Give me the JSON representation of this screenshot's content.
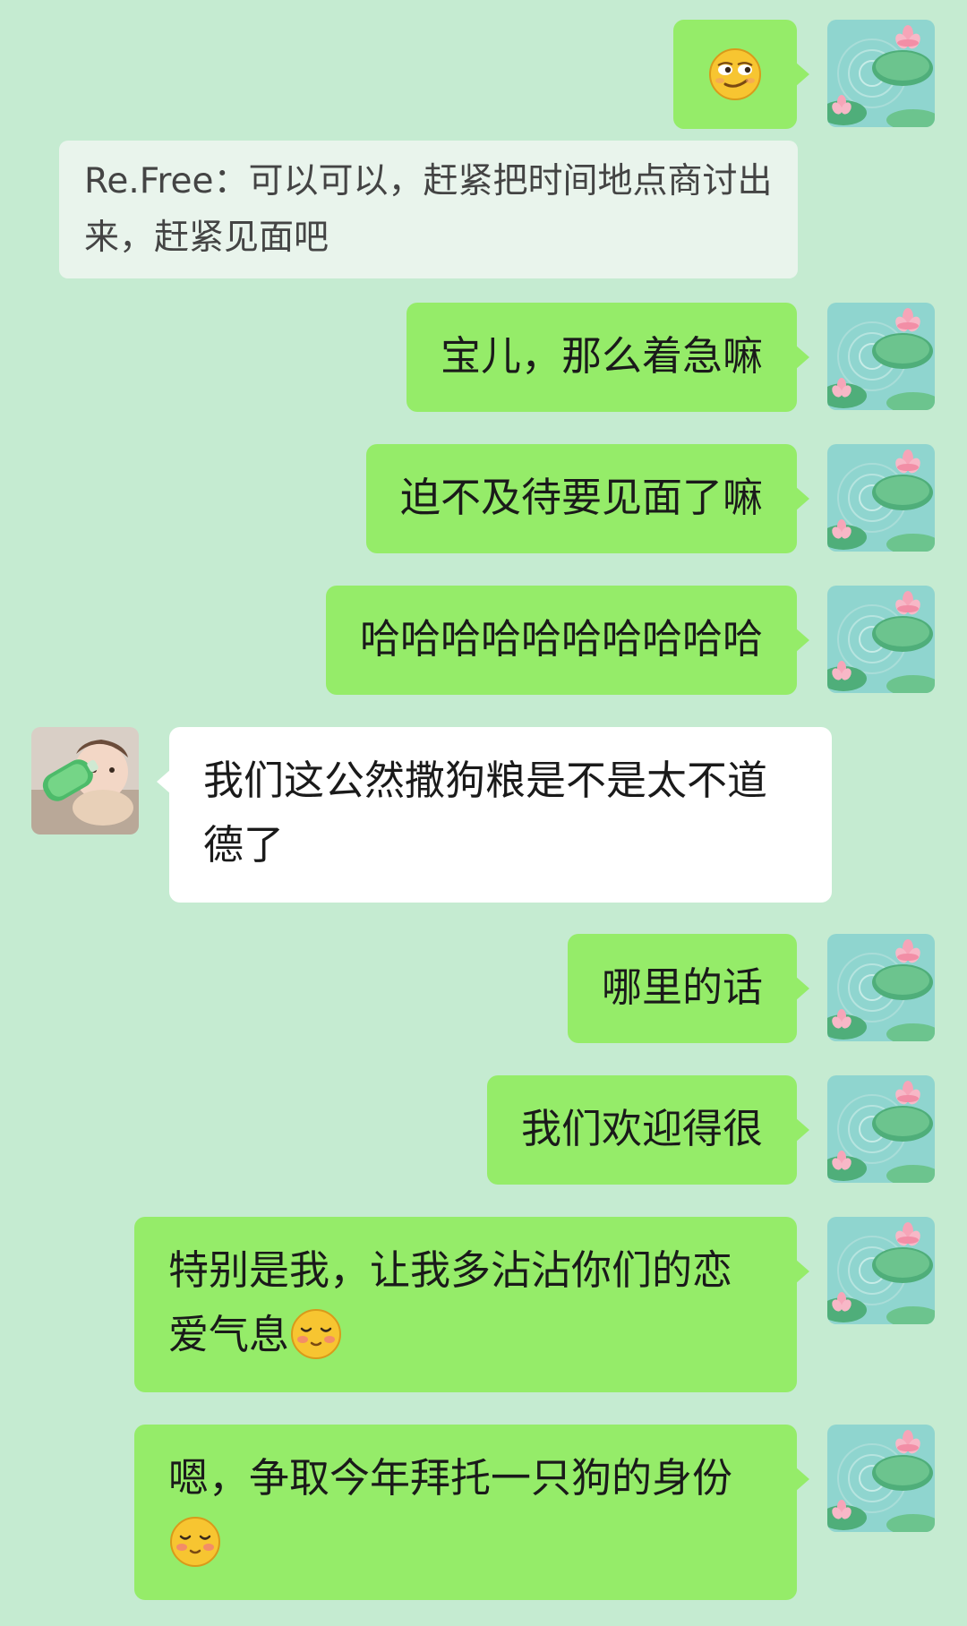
{
  "chat": {
    "quote": {
      "sender": "Re.Free",
      "separator": "：",
      "text": "可以可以，赶紧把时间地点商讨出来，赶紧见面吧"
    },
    "messages": [
      {
        "id": "m1",
        "from": "me",
        "text": "",
        "emoji": "smirk-face-icon"
      },
      {
        "id": "m2",
        "from": "me",
        "text": "宝儿，那么着急嘛"
      },
      {
        "id": "m3",
        "from": "me",
        "text": "迫不及待要见面了嘛"
      },
      {
        "id": "m4",
        "from": "me",
        "text": "哈哈哈哈哈哈哈哈哈哈"
      },
      {
        "id": "m5",
        "from": "other",
        "text": "我们这公然撒狗粮是不是太不道德了"
      },
      {
        "id": "m6",
        "from": "me",
        "text": "哪里的话"
      },
      {
        "id": "m7",
        "from": "me",
        "text": "我们欢迎得很"
      },
      {
        "id": "m8",
        "from": "me",
        "text": "特别是我，让我多沾沾你们的恋爱气息",
        "emoji": "shy-face-icon"
      },
      {
        "id": "m9",
        "from": "me",
        "text": "嗯，争取今年拜托一只狗的身份",
        "emoji": "shy-face-icon"
      }
    ]
  },
  "colors": {
    "background": "#c5ebd1",
    "my_bubble": "#95ec69",
    "other_bubble": "#ffffff",
    "quote_bg": "#e9f4ec"
  },
  "avatars": {
    "me": "lotus-pond-avatar-icon",
    "other": "baby-with-bottle-avatar-icon"
  }
}
